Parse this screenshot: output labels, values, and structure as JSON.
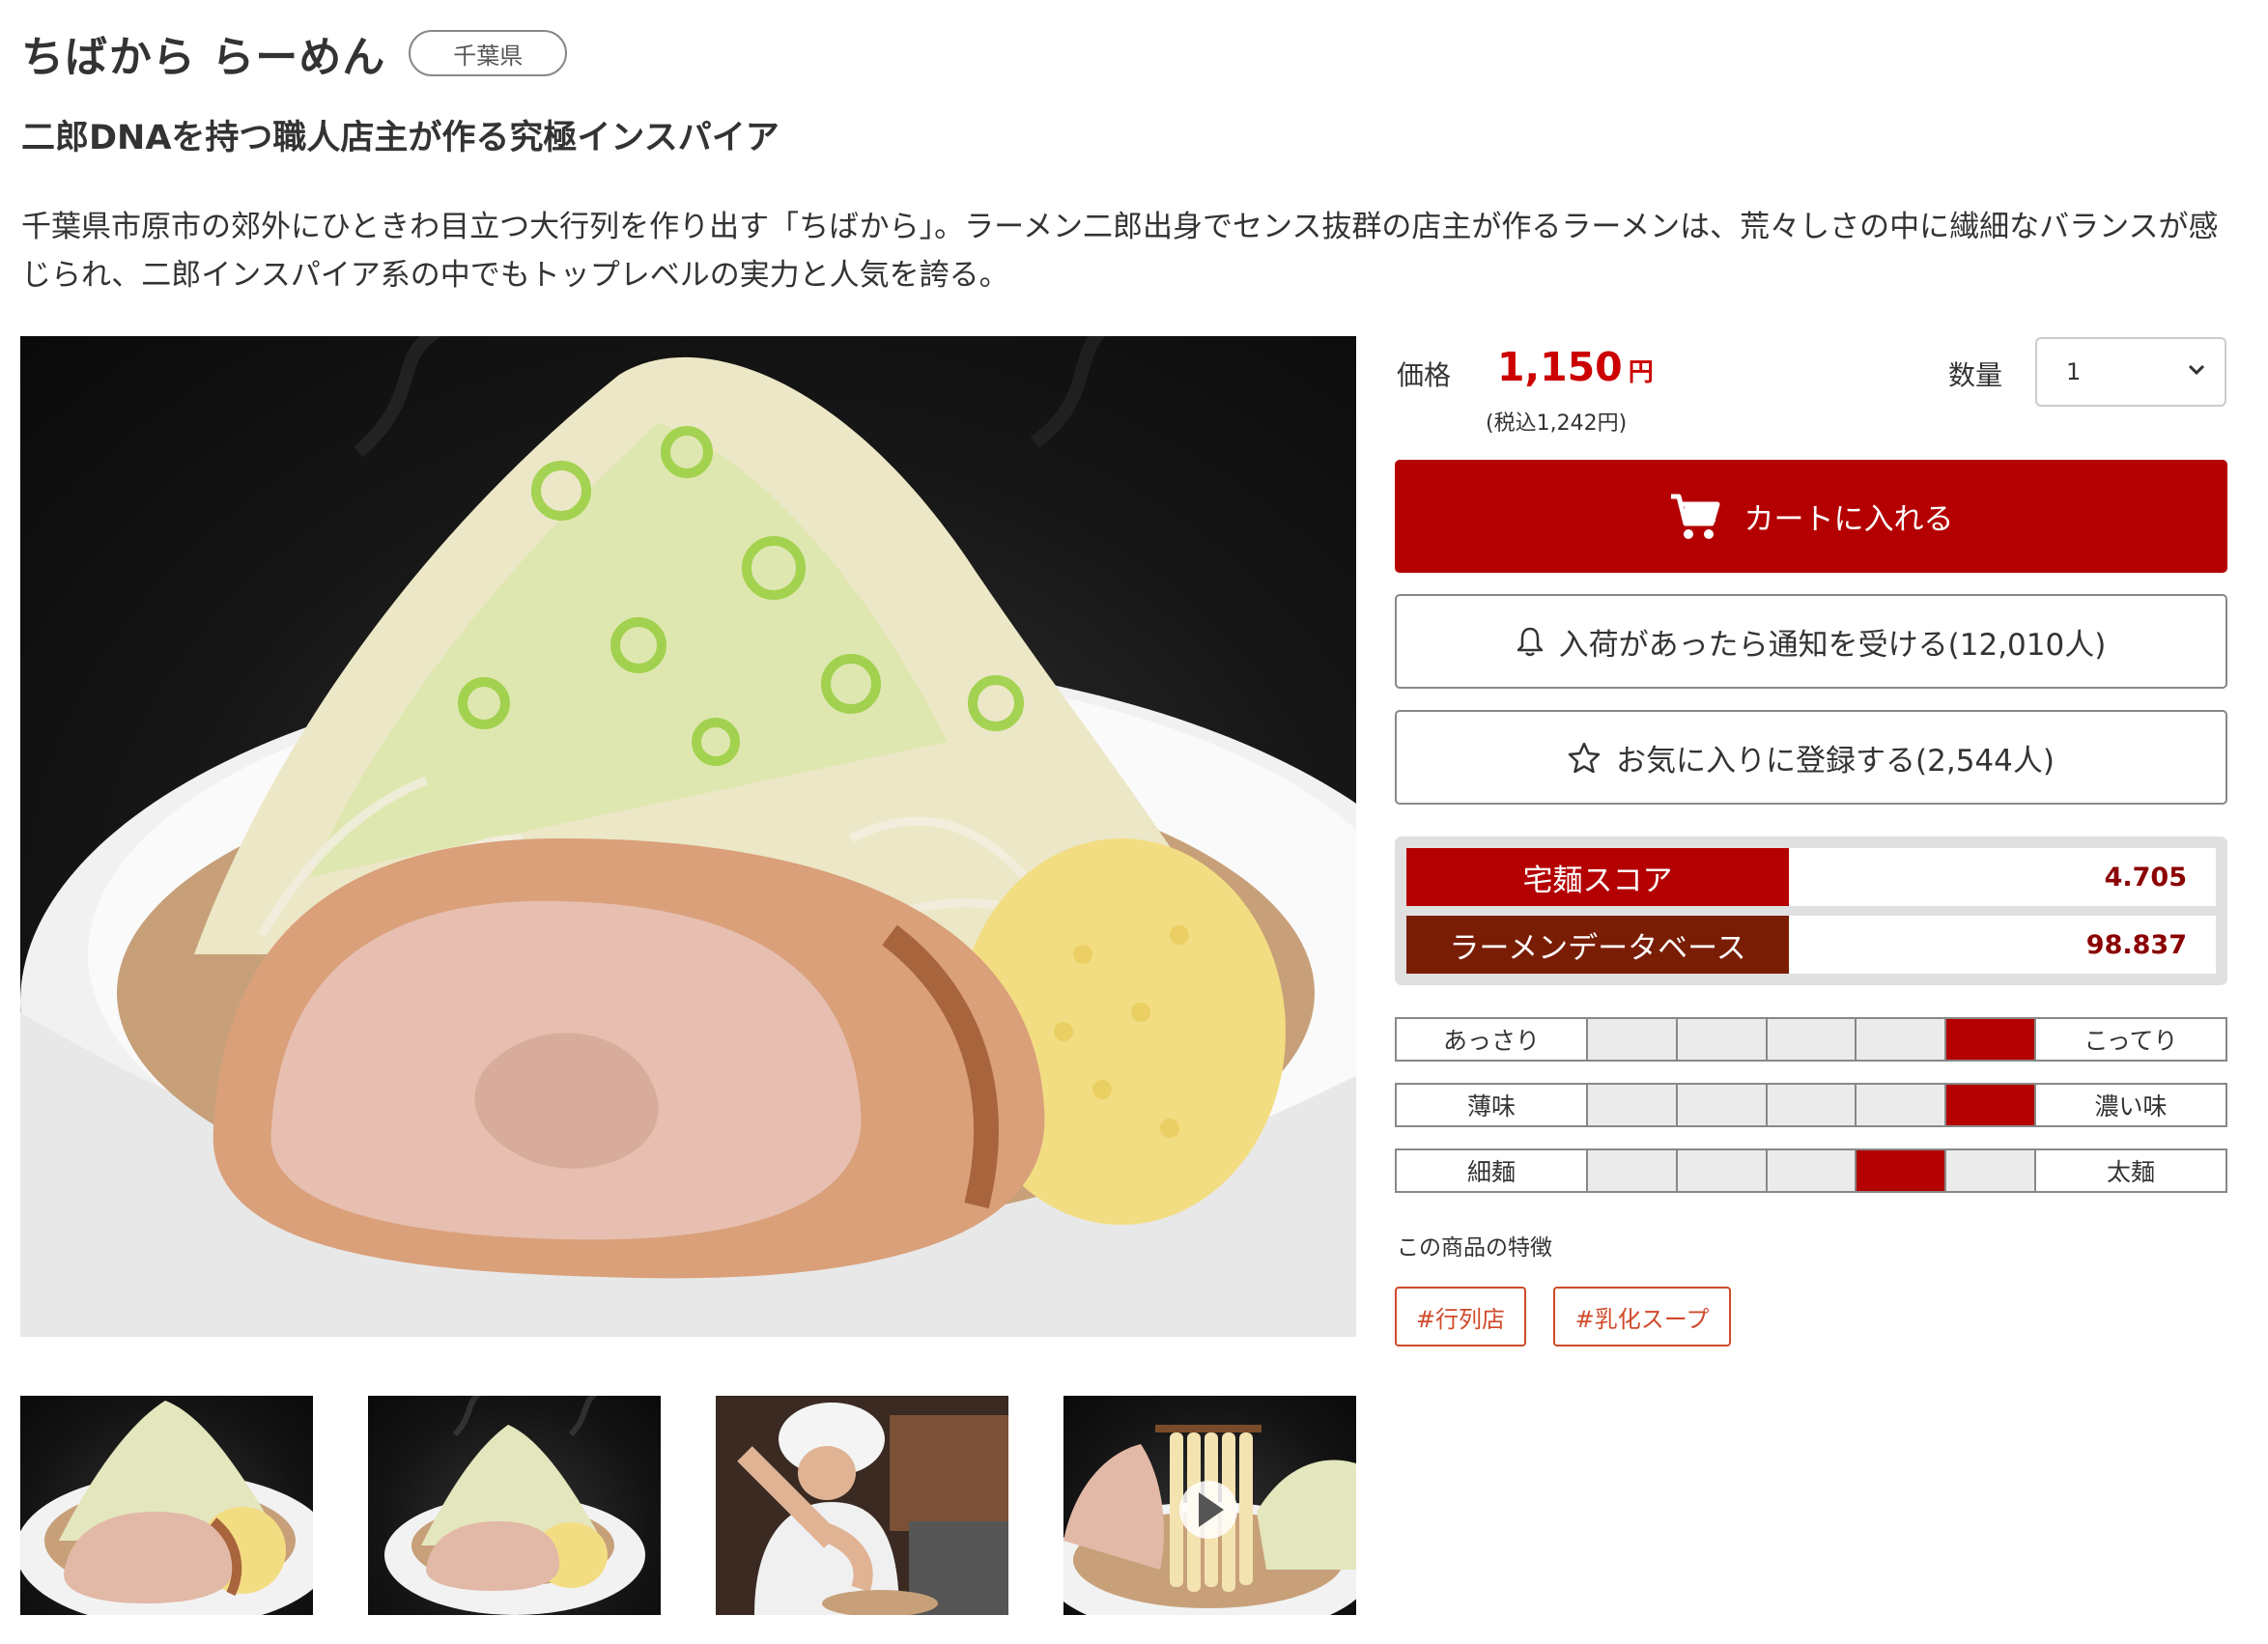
{
  "product": {
    "name": "ちばから らーめん",
    "prefecture": "千葉県",
    "subtitle": "二郎DNAを持つ職人店主が作る究極インスパイア",
    "description": "千葉県市原市の郊外にひときわ目立つ大行列を作り出す「ちばから」。ラーメン二郎出身でセンス抜群の店主が作るラーメンは、荒々しさの中に繊細なバランスが感じられ、二郎インスパイア系の中でもトップレベルの実力と人気を誇る。"
  },
  "purchase": {
    "price_label": "価格",
    "price": "1,150",
    "currency": "円",
    "tax_included": "(税込1,242円)",
    "quantity_label": "数量",
    "quantity_value": "1",
    "cart_button": "カートに入れる",
    "notify_button": "入荷があったら通知を受ける(12,010人)",
    "favorite_button": "お気に入りに登録する(2,544人)"
  },
  "scores": [
    {
      "label": "宅麺スコア",
      "value": "4.705",
      "color": "#b40000"
    },
    {
      "label": "ラーメンデータベース",
      "value": "98.837",
      "color": "#7a1d05"
    }
  ],
  "taste_scales": [
    {
      "left": "あっさり",
      "right": "こってり",
      "level": 5,
      "steps": 5
    },
    {
      "left": "薄味",
      "right": "濃い味",
      "level": 5,
      "steps": 5
    },
    {
      "left": "細麺",
      "right": "太麺",
      "level": 4,
      "steps": 5
    }
  ],
  "features": {
    "label": "この商品の特徴",
    "tags": [
      "#行列店",
      "#乳化スープ"
    ]
  },
  "images": {
    "main": "ramen-bowl-photo",
    "thumbnails": [
      "ramen-bowl-photo",
      "ramen-bowl-photo-steam",
      "chef-cooking-photo",
      "noodle-lift-video"
    ]
  },
  "colors": {
    "accent": "#b40000",
    "price": "#cc0000",
    "database_score": "#7a1d05",
    "tag": "#d04a2a"
  }
}
